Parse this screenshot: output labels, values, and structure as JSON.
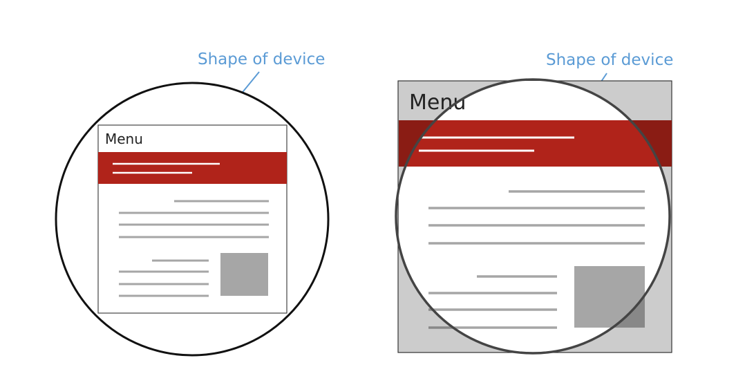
{
  "left_panel": {
    "callout_label": "Shape of device",
    "menu_label": "Menu"
  },
  "right_panel": {
    "callout_label": "Shape of device",
    "menu_label": "Menu"
  },
  "colors": {
    "header_band": "#b0231a",
    "header_band_dimmed": "#8a1c14",
    "callout": "#5b9bd5",
    "text_line": "#a6a6a6",
    "image_block": "#a6a6a6",
    "masked_area": "#cccccc"
  }
}
